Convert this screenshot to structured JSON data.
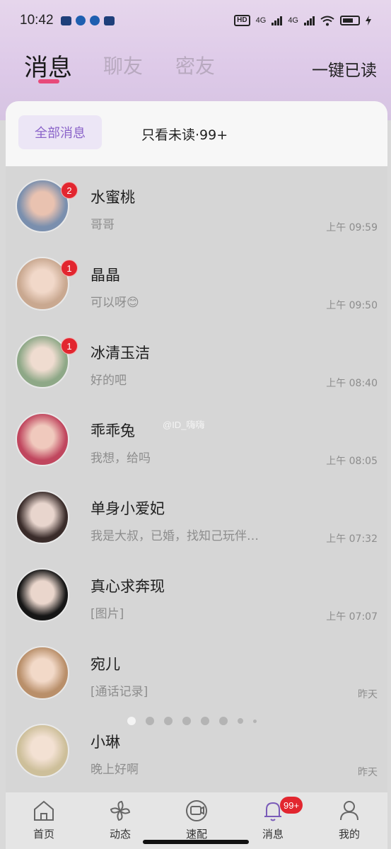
{
  "status_bar": {
    "time": "10:42",
    "hd": "HD",
    "net1": "4G",
    "net2": "4G"
  },
  "header": {
    "tabs": [
      "消息",
      "聊友",
      "密友"
    ],
    "mark_all_read": "一键已读"
  },
  "filter": {
    "all": "全部消息",
    "unread": "只看未读·99+"
  },
  "conversations": [
    {
      "name": "水蜜桃",
      "preview": "哥哥",
      "time": "上午 09:59",
      "badge": "2",
      "avatar_colors": [
        "#7a8fae",
        "#e9c2b0"
      ]
    },
    {
      "name": "晶晶",
      "preview": "可以呀😊",
      "time": "上午 09:50",
      "badge": "1",
      "avatar_colors": [
        "#c9a890",
        "#f1d8c9"
      ]
    },
    {
      "name": "冰清玉洁",
      "preview": "好的吧",
      "time": "上午 08:40",
      "badge": "1",
      "avatar_colors": [
        "#8ea887",
        "#efdcd0"
      ]
    },
    {
      "name": "乖乖兔",
      "preview": "我想，给吗",
      "time": "上午 08:05",
      "badge": "",
      "avatar_colors": [
        "#c0465e",
        "#f0c9bd"
      ]
    },
    {
      "name": "单身小爱妃",
      "preview": "我是大叔，已婚，找知己玩伴…",
      "time": "上午 07:32",
      "badge": "",
      "avatar_colors": [
        "#3a2c2a",
        "#e8d5cd"
      ]
    },
    {
      "name": "真心求奔现",
      "preview": "[图片]",
      "time": "上午 07:07",
      "badge": "",
      "avatar_colors": [
        "#161616",
        "#ead6cc"
      ]
    },
    {
      "name": "宛儿",
      "preview": "[通话记录]",
      "time": "昨天",
      "badge": "",
      "avatar_colors": [
        "#b98f6a",
        "#f2d9c8"
      ]
    },
    {
      "name": "小琳",
      "preview": "晚上好啊",
      "time": "昨天",
      "badge": "",
      "avatar_colors": [
        "#cdbf9a",
        "#f3e1d3"
      ]
    }
  ],
  "watermark": "@ID_嗨嗨",
  "bottom_nav": [
    {
      "label": "首页",
      "icon": "home-icon"
    },
    {
      "label": "动态",
      "icon": "pinwheel-icon"
    },
    {
      "label": "速配",
      "icon": "video-match-icon"
    },
    {
      "label": "消息",
      "icon": "bell-icon",
      "badge": "99+"
    },
    {
      "label": "我的",
      "icon": "user-icon"
    }
  ],
  "colors": {
    "accent": "#8a63c9",
    "badge": "#e2262f",
    "tab_underline": "#e84a7a"
  }
}
